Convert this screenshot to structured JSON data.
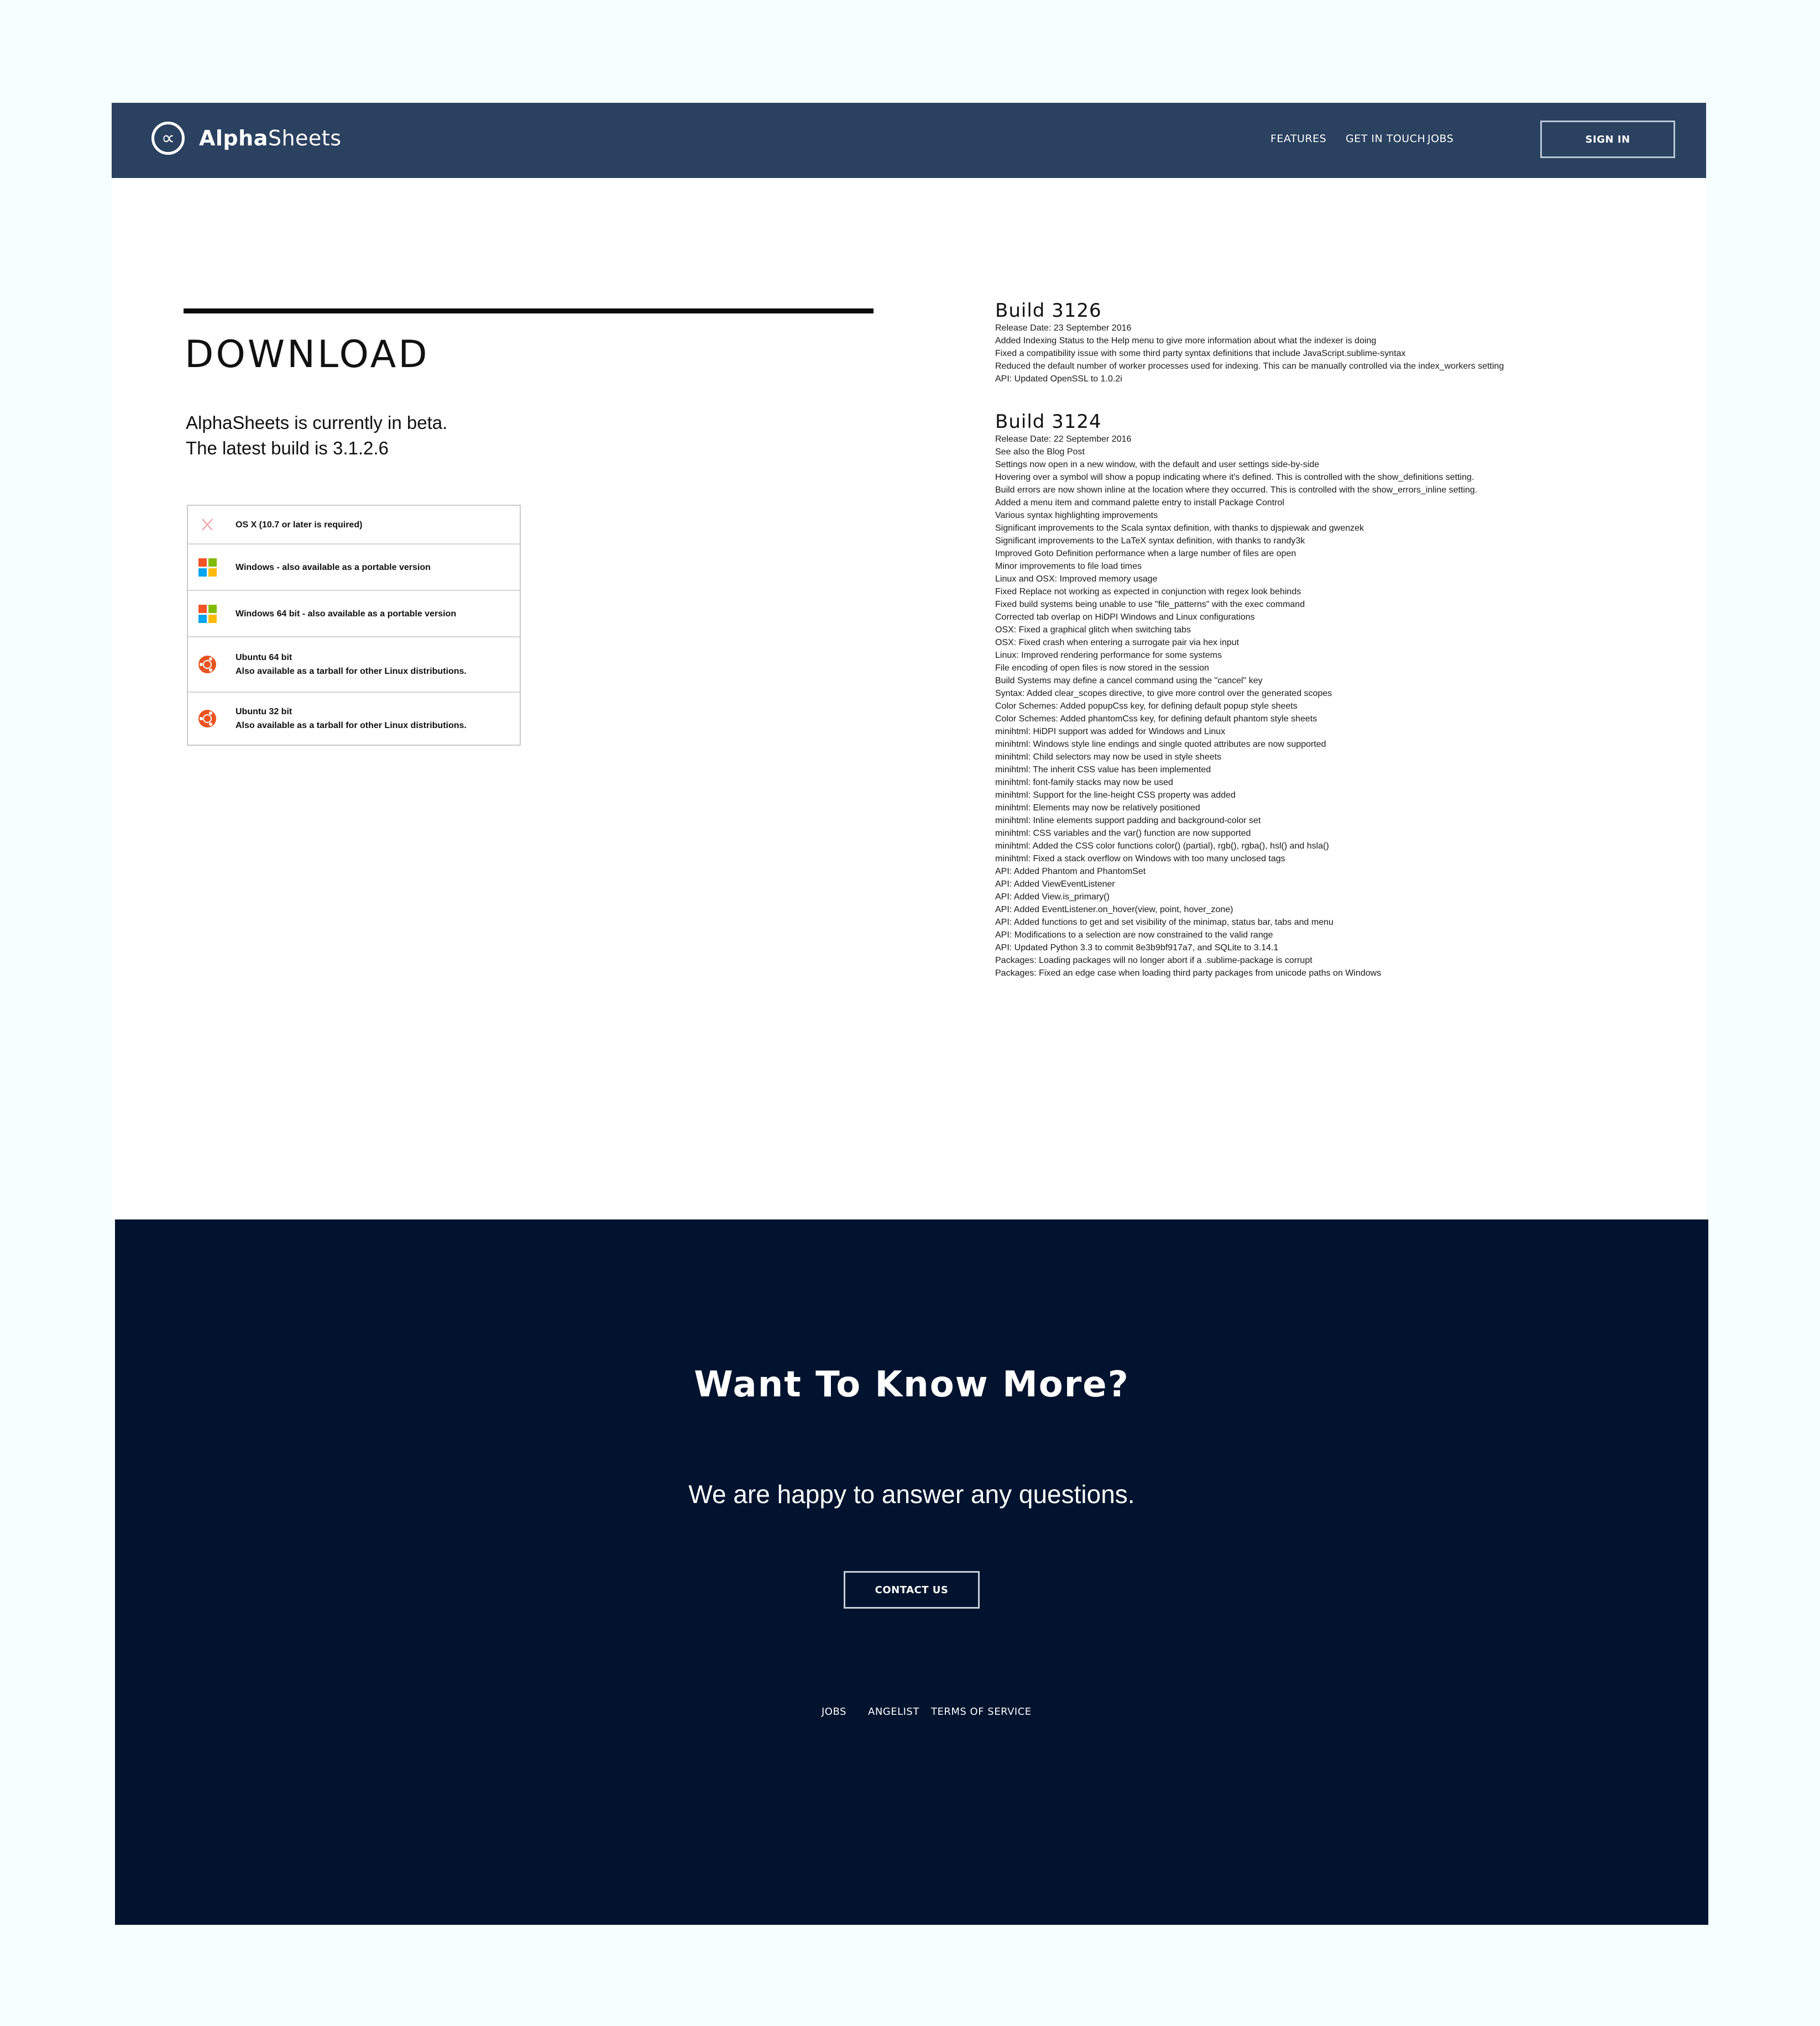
{
  "brand": {
    "name_bold": "Alpha",
    "name_rest": "Sheets",
    "logo_glyph": "∝"
  },
  "nav": {
    "features": "FEATURES",
    "get_in_touch": "GET IN TOUCH",
    "jobs": "JOBS",
    "sign_in": "SIGN IN"
  },
  "download": {
    "title": "DOWNLOAD",
    "beta_line1": "AlphaSheets is currently in beta.",
    "beta_line2": "The latest build is 3.1.2.6",
    "items": [
      {
        "icon": "apple-x-icon",
        "line1": "OS X (10.7 or later is required)",
        "line2": ""
      },
      {
        "icon": "windows-icon",
        "line1": "Windows - also available as a portable version",
        "line2": ""
      },
      {
        "icon": "windows-icon",
        "line1": "Windows 64 bit - also available as a portable version",
        "line2": ""
      },
      {
        "icon": "ubuntu-icon",
        "line1": "Ubuntu 64 bit",
        "line2": "Also available as a tarball for other Linux distributions."
      },
      {
        "icon": "ubuntu-icon",
        "line1": "Ubuntu 32 bit",
        "line2": "Also available as a tarball for other Linux distributions."
      }
    ]
  },
  "builds": [
    {
      "title": "Build 3126",
      "lines": [
        "Release Date: 23 September 2016",
        "Added Indexing Status to the Help menu to give more information about what the indexer is doing",
        "Fixed a compatibility issue with some third party syntax definitions that include JavaScript.sublime-syntax",
        "Reduced the default number of worker processes used for indexing. This can be manually controlled via the index_workers setting",
        "API: Updated OpenSSL to 1.0.2i"
      ]
    },
    {
      "title": "Build 3124",
      "lines": [
        "Release Date: 22 September 2016",
        "See also the Blog Post",
        "Settings now open in a new window, with the default and user settings side-by-side",
        "Hovering over a symbol will show a popup indicating where it's defined. This is controlled with the show_definitions setting.",
        "Build errors are now shown inline at the location where they occurred. This is controlled with the show_errors_inline setting.",
        "Added a menu item and command palette entry to install Package Control",
        "Various syntax highlighting improvements",
        "Significant improvements to the Scala syntax definition, with thanks to djspiewak and gwenzek",
        "Significant improvements to the LaTeX syntax definition, with thanks to randy3k",
        "Improved Goto Definition performance when a large number of files are open",
        "Minor improvements to file load times",
        "Linux and OSX: Improved memory usage",
        "Fixed Replace not working as expected in conjunction with regex look behinds",
        "Fixed build systems being unable to use \"file_patterns\" with the exec command",
        "Corrected tab overlap on HiDPI Windows and Linux configurations",
        "OSX: Fixed a graphical glitch when switching tabs",
        "OSX: Fixed crash when entering a surrogate pair via hex input",
        "Linux: Improved rendering performance for some systems",
        "File encoding of open files is now stored in the session",
        "Build Systems may define a cancel command using the \"cancel\" key",
        "Syntax: Added clear_scopes directive, to give more control over the generated scopes",
        "Color Schemes: Added popupCss key, for defining default popup style sheets",
        "Color Schemes: Added phantomCss key, for defining default phantom style sheets",
        "minihtml: HiDPI support was added for Windows and Linux",
        "minihtml: Windows style line endings and single quoted attributes are now supported",
        "minihtml: Child selectors may now be used in style sheets",
        "minihtml: The inherit CSS value has been implemented",
        "minihtml: font-family stacks may now be used",
        "minihtml: Support for the line-height CSS property was added",
        "minihtml: Elements may now be relatively positioned",
        "minihtml: Inline elements support padding and background-color set",
        "minihtml: CSS variables and the var() function are now supported",
        "minihtml: Added the CSS color functions color() (partial), rgb(), rgba(), hsl() and hsla()",
        "minihtml: Fixed a stack overflow on Windows with too many unclosed tags",
        "API: Added Phantom and PhantomSet",
        "API: Added ViewEventListener",
        "API: Added View.is_primary()",
        "API: Added EventListener.on_hover(view, point, hover_zone)",
        "API: Added functions to get and set visibility of the minimap, status bar, tabs and menu",
        "API: Modifications to a selection are now constrained to the valid range",
        "API: Updated Python 3.3 to commit 8e3b9bf917a7, and SQLite to 3.14.1",
        "Packages: Loading packages will no longer abort if a .sublime-package is corrupt",
        "Packages: Fixed an edge case when loading third party packages from unicode paths on Windows"
      ]
    }
  ],
  "footer": {
    "heading": "Want To Know More?",
    "subheading": "We are happy to answer any questions.",
    "contact": "CONTACT US",
    "links": [
      "JOBS",
      "ANGELIST",
      "TERMS OF SERVICE"
    ]
  },
  "colors": {
    "nav_bg": "#2a4160",
    "footer_bg": "#01132e",
    "page_bg": "#f5fffe",
    "ubuntu": "#e95420"
  }
}
